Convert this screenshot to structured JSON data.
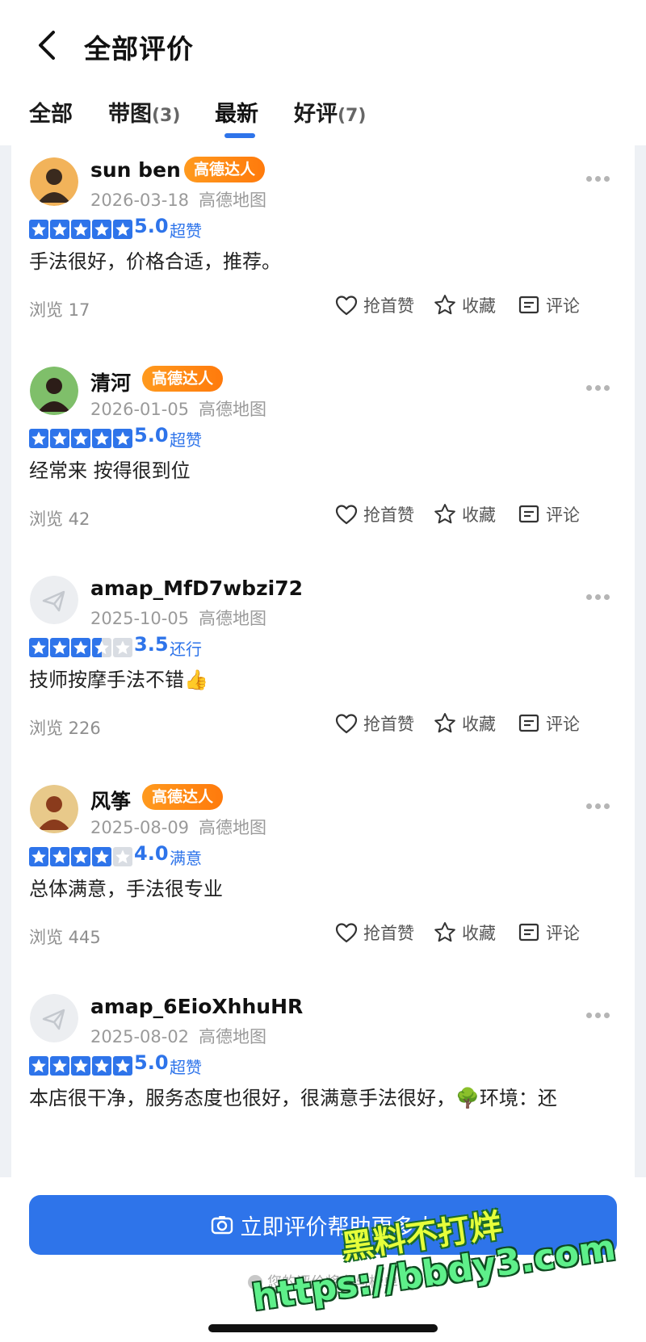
{
  "header": {
    "title": "全部评价",
    "back_icon": "chevron-left-icon"
  },
  "tabs": [
    {
      "label": "全部",
      "count": ""
    },
    {
      "label": "带图",
      "count": "(3)"
    },
    {
      "label": "最新",
      "count": ""
    },
    {
      "label": "好评",
      "count": "(7)"
    }
  ],
  "selected_tab": "最新",
  "reviews": [
    {
      "user": "sun ben",
      "badge": "高德达人",
      "date": "2026-03-18",
      "source": "高德地图",
      "rating": 5.0,
      "score": "5.0",
      "rating_word": "超赞",
      "content": "手法很好，价格合适，推荐。",
      "views": "浏览 17"
    },
    {
      "user": "清河",
      "badge": "高德达人",
      "date": "2026-01-05",
      "source": "高德地图",
      "rating": 5.0,
      "score": "5.0",
      "rating_word": "超赞",
      "content": "经常来 按得很到位",
      "views": "浏览 42"
    },
    {
      "user": "amap_MfD7wbzi72",
      "badge": "",
      "date": "2025-10-05",
      "source": "高德地图",
      "rating": 3.5,
      "score": "3.5",
      "rating_word": "还行",
      "content": "技师按摩手法不错👍",
      "views": "浏览 226"
    },
    {
      "user": "风筝",
      "badge": "高德达人",
      "date": "2025-08-09",
      "source": "高德地图",
      "rating": 4.0,
      "score": "4.0",
      "rating_word": "满意",
      "content": "总体满意，手法很专业",
      "views": "浏览 445"
    },
    {
      "user": "amap_6EioXhhuHR",
      "badge": "",
      "date": "2025-08-02",
      "source": "高德地图",
      "rating": 5.0,
      "score": "5.0",
      "rating_word": "超赞",
      "content": "本店很干净，服务态度也很好，很满意手法很好，🌳环境：还",
      "views": ""
    }
  ],
  "actions": {
    "like": "抢首赞",
    "favorite": "收藏",
    "comment": "评论"
  },
  "bottom": {
    "cta": "立即评价帮助更多人",
    "hint": "您的评价将参与榜单"
  },
  "watermark": {
    "line1": "黑料不打烊",
    "line2": "https://bbdy3.com"
  },
  "colors": {
    "accent": "#2e74ea",
    "badge": "#ff8a15",
    "star_empty": "#d9dde3"
  }
}
